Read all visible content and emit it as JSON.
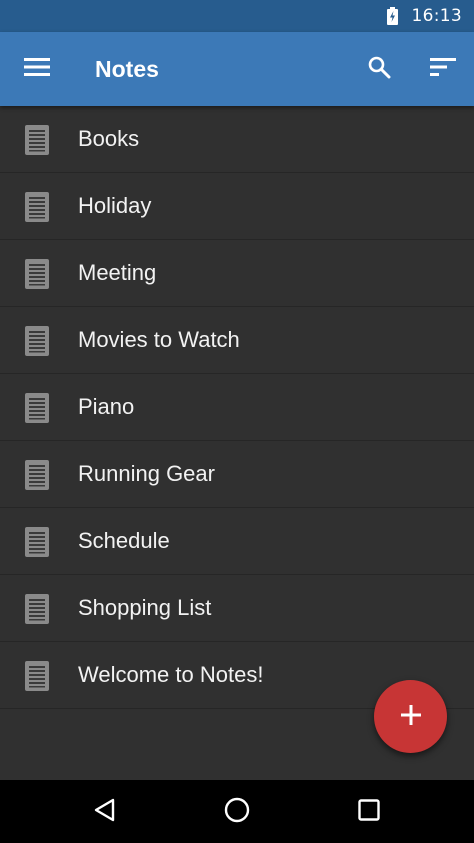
{
  "status_bar": {
    "time": "16:13",
    "battery_icon": "battery-charging-icon"
  },
  "app_bar": {
    "title": "Notes",
    "menu_icon": "hamburger-menu-icon",
    "search_icon": "search-icon",
    "sort_icon": "sort-icon",
    "background": "#3c79b7"
  },
  "notes": [
    {
      "title": "Books"
    },
    {
      "title": "Holiday"
    },
    {
      "title": "Meeting"
    },
    {
      "title": "Movies to Watch"
    },
    {
      "title": "Piano"
    },
    {
      "title": "Running Gear"
    },
    {
      "title": "Schedule"
    },
    {
      "title": "Shopping List"
    },
    {
      "title": "Welcome to Notes!"
    }
  ],
  "fab": {
    "icon": "plus-icon",
    "color": "#c73535"
  },
  "nav_bar": {
    "back_icon": "back-triangle-icon",
    "home_icon": "home-circle-icon",
    "recents_icon": "recents-square-icon"
  }
}
